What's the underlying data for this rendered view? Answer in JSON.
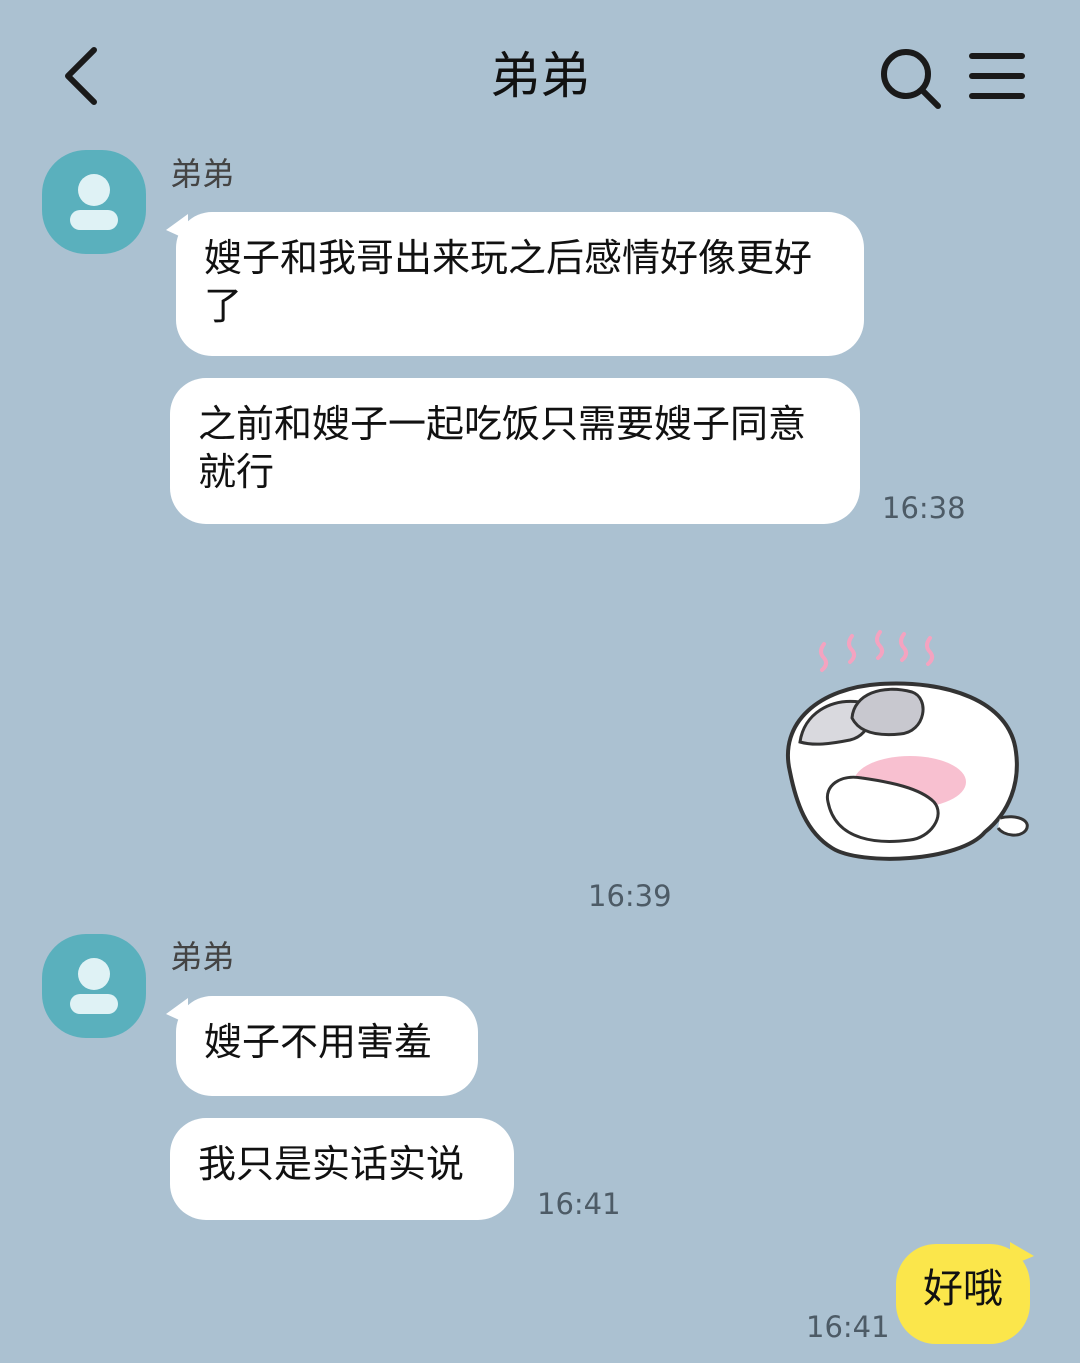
{
  "header": {
    "title": "弟弟",
    "back_icon": "chevron-left-icon",
    "search_icon": "search-icon",
    "menu_icon": "hamburger-menu-icon"
  },
  "messages": [
    {
      "sender": "弟弟",
      "bubbles": [
        "嫂子和我哥出来玩之后感情好像更好了",
        "之前和嫂子一起吃饭只需要嫂子同意就行"
      ],
      "time": "16:38"
    },
    {
      "sticker": "shy-bunny-sticker",
      "time": "16:39"
    },
    {
      "sender": "弟弟",
      "bubbles": [
        "嫂子不用害羞",
        "我只是实话实说"
      ],
      "time": "16:41"
    },
    {
      "mine": true,
      "bubbles": [
        "好哦"
      ],
      "time": "16:41"
    }
  ],
  "colors": {
    "background": "#abc1d1",
    "avatar": "#5ab0bd",
    "my_bubble": "#fbe64b",
    "other_bubble": "#ffffff"
  }
}
